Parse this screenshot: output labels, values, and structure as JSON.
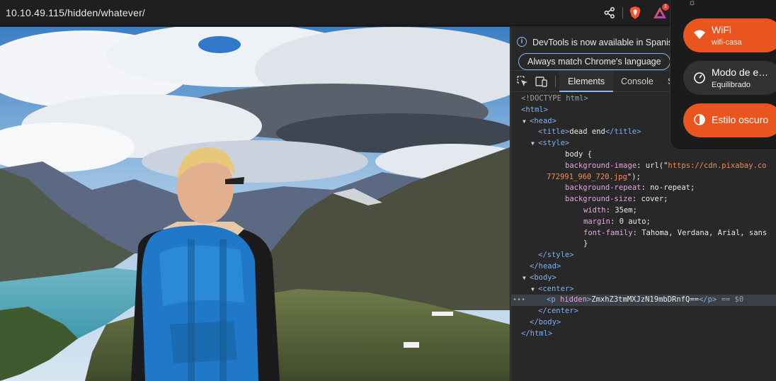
{
  "browser": {
    "url": "10.10.49.115/hidden/whatever/",
    "rewards_badge": "1"
  },
  "page": {
    "background_image": "hiker-with-blue-backpack-mountains"
  },
  "devtools": {
    "infobar_text": "DevTools is now available in Spanish",
    "match_language_button": "Always match Chrome's language",
    "tabs": [
      "Elements",
      "Console",
      "S"
    ],
    "code": {
      "doctype": "<!DOCTYPE html>",
      "html_open": "<html>",
      "head_open": "<head>",
      "title_open": "<title>",
      "title_text": "dead end",
      "title_close": "</title>",
      "style_open": "<style>",
      "body_sel": "body {",
      "bg_image_prop": "background-image",
      "bg_image_pre": ": url(\"",
      "bg_image_val": "https://cdn.pixabay.co",
      "bg_image_val2": "772991_960_720.jpg",
      "bg_image_end": "\");",
      "bg_repeat_prop": "background-repeat",
      "bg_repeat_val": ": no-repeat;",
      "bg_size_prop": "background-size",
      "bg_size_val": ": cover;",
      "width_prop": "width",
      "width_val": ": 35em;",
      "margin_prop": "margin",
      "margin_val": ": 0 auto;",
      "font_prop": "font-family",
      "font_val": ": Tahoma, Verdana, Arial, sans",
      "close_brace": "}",
      "style_close": "</style>",
      "head_close": "</head>",
      "body_open": "<body>",
      "center_open": "<center>",
      "p_open": "<p",
      "p_attr": " hidden",
      "p_gt": ">",
      "p_text": "ZmxhZ3tmMXJzN19mbDRnfQ==",
      "p_close": "</p>",
      "p_marker": " == $0",
      "center_close": "</center>",
      "body_close": "</body>",
      "html_close": "</html>"
    }
  },
  "quick_settings": {
    "wifi_title": "WiFi",
    "wifi_sub": "wifi-casa",
    "power_title": "Modo de e…",
    "power_sub": "Equilibrado",
    "dark_title": "Estilo oscuro",
    "accent": "#e9541f"
  }
}
